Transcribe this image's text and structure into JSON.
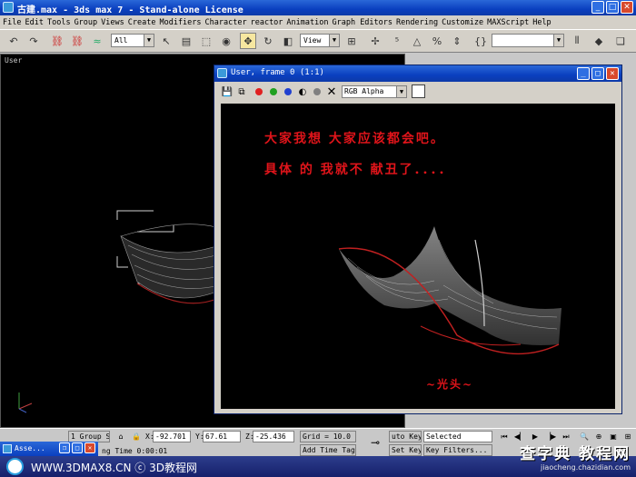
{
  "window": {
    "title": "古建.max - 3ds max 7 - Stand-alone License"
  },
  "menubar": [
    "File",
    "Edit",
    "Tools",
    "Group",
    "Views",
    "Create",
    "Modifiers",
    "Character",
    "reactor",
    "Animation",
    "Graph Editors",
    "Rendering",
    "Customize",
    "MAXScript",
    "Help"
  ],
  "toolbar": {
    "filter_value": "All",
    "viewref_value": "View"
  },
  "viewport": {
    "label": "User"
  },
  "render_window": {
    "title": "User, frame 0 (1:1)",
    "channel_value": "RGB Alpha",
    "line1": "大家我想 大家应该都会吧。",
    "line2": "具体 的 我就不 献丑了．．．．",
    "signature": "~光头~"
  },
  "status": {
    "selection": "1 Group S",
    "x_label": "X:",
    "x_value": "-92.701",
    "y_label": "Y:",
    "y_value": "67.61",
    "z_label": "Z:",
    "z_value": "-25.436",
    "grid": "Grid = 10.0",
    "auto_key": "uto Key",
    "set_key": "Set Key",
    "key_mode_value": "Selected",
    "key_filters": "Key Filters...",
    "add_time_tag": "Add Time Tag",
    "time_text": "ng Time 0:00:01"
  },
  "mini_window": {
    "title": "Asse..."
  },
  "banner": {
    "text": "WWW.3DMAX8.CN ⓒ 3D教程网"
  },
  "watermark": {
    "big": "查字典 教程网",
    "small": "jiaocheng.chazidian.com"
  }
}
